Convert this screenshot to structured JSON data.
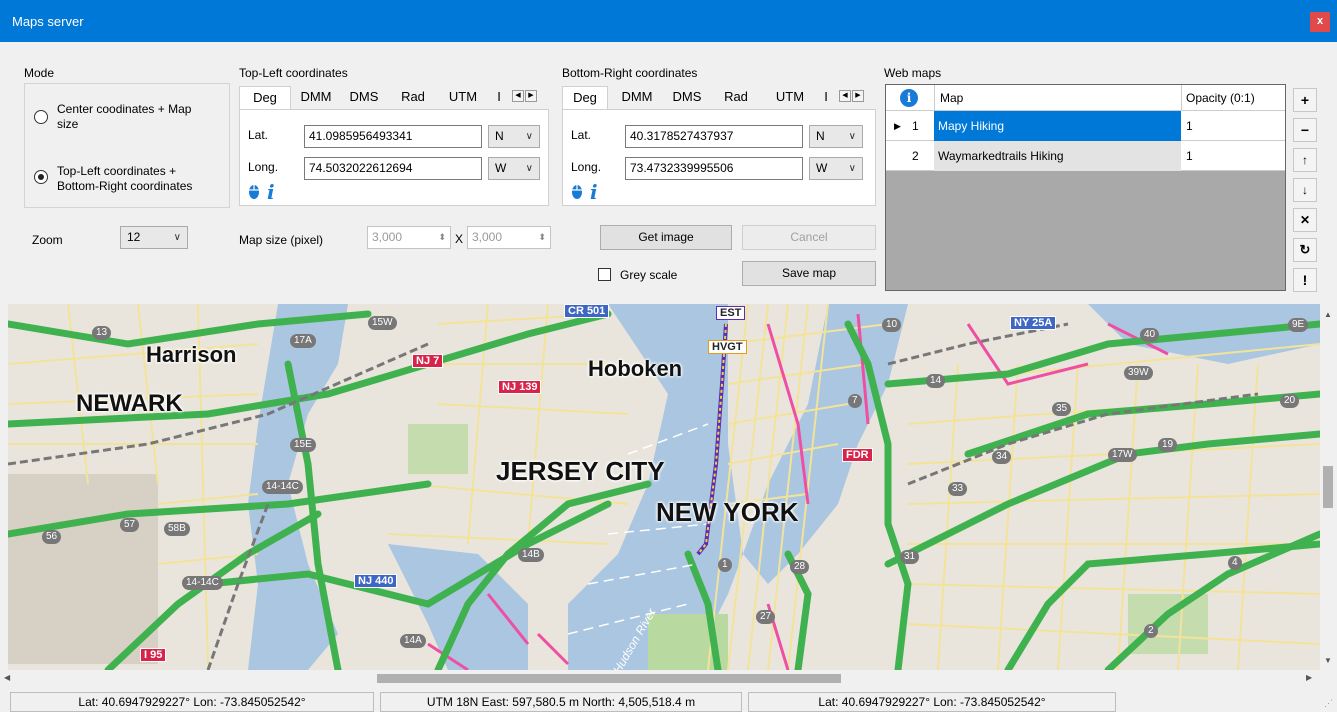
{
  "window": {
    "title": "Maps server",
    "close": "x"
  },
  "mode": {
    "label": "Mode",
    "option1": "Center coodinates + Map size",
    "option1_line1": "Center coodinates + Map",
    "option1_line2": "size",
    "option2_line1": "Top-Left coordinates +",
    "option2_line2": "Bottom-Right coordinates",
    "selected": "option2"
  },
  "top_left": {
    "label": "Top-Left coordinates",
    "tabs": [
      "Deg",
      "DMM",
      "DMS",
      "Rad",
      "UTM",
      "I"
    ],
    "lat_label": "Lat.",
    "lat_value": "41.0985956493341",
    "lat_dir": "N",
    "lon_label": "Long.",
    "lon_value": "74.5032022612694",
    "lon_dir": "W"
  },
  "bottom_right": {
    "label": "Bottom-Right coordinates",
    "tabs": [
      "Deg",
      "DMM",
      "DMS",
      "Rad",
      "UTM",
      "I"
    ],
    "lat_label": "Lat.",
    "lat_value": "40.3178527437937",
    "lat_dir": "N",
    "lon_label": "Long.",
    "lon_value": "73.4732339995506",
    "lon_dir": "W"
  },
  "zoom": {
    "label": "Zoom",
    "value": "12"
  },
  "map_size": {
    "label": "Map size (pixel)",
    "width": "3,000",
    "x": "X",
    "height": "3,000"
  },
  "buttons": {
    "get_image": "Get image",
    "cancel": "Cancel",
    "save_map": "Save map"
  },
  "grey_scale": {
    "label": "Grey scale",
    "checked": false
  },
  "web_maps": {
    "label": "Web maps",
    "headers": [
      "Map",
      "Opacity (0:1)"
    ],
    "rows": [
      {
        "index": "1",
        "map": "Mapy Hiking",
        "opacity": "1",
        "selected": true
      },
      {
        "index": "2",
        "map": "Waymarkedtrails Hiking",
        "opacity": "1",
        "selected": false
      }
    ],
    "side_buttons": [
      "+",
      "−",
      "↑",
      "↓",
      "✕",
      "↻",
      "!"
    ]
  },
  "map": {
    "cities": [
      "Harrison",
      "NEWARK",
      "Hoboken",
      "JERSEY CITY",
      "NEW YORK"
    ],
    "shields": [
      "NJ 7",
      "NJ 139",
      "CR 501",
      "EST",
      "HVGT",
      "FDR",
      "NJ 440",
      "I 95",
      "NY 25A"
    ],
    "road_numbers": [
      "13",
      "15W",
      "17A",
      "15E",
      "14-14C",
      "57",
      "58B",
      "56",
      "14B",
      "14-14C",
      "14A",
      "10",
      "14",
      "7",
      "35",
      "39W",
      "40",
      "9E",
      "20",
      "19",
      "34",
      "17W",
      "33",
      "31",
      "28",
      "1",
      "27",
      "2",
      "4"
    ],
    "river_label": "Hudson River"
  },
  "status": {
    "left": "Lat: 40.6947929227°  Lon: -73.845052542°",
    "middle": "UTM 18N  East: 597,580.5  m  North: 4,505,518.4  m",
    "right": "Lat: 40.6947929227°  Lon: -73.845052542°"
  },
  "colors": {
    "titlebar": "#0078d7",
    "selection": "#0078d7",
    "close": "#e04a4a"
  }
}
